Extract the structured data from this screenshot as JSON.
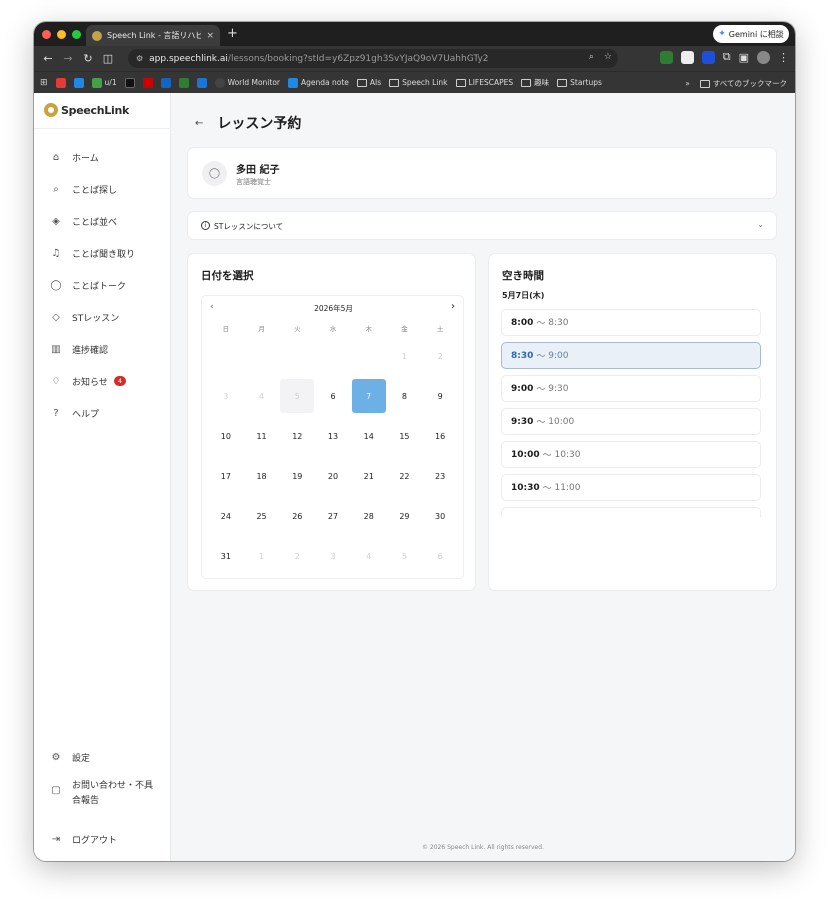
{
  "browser": {
    "tab_title": "Speech Link - 言語リハビリ支援",
    "new_tab": "+",
    "close": "×",
    "gemini_label": "Gemini に相談",
    "url_host": "app.speechlink.ai",
    "url_path": "/lessons/booking?stId=y6Zpz91gh3SvYJaQ9oV7UahhGTy2",
    "bookmarks": [
      "u/1",
      "World Monitor",
      "Agenda note",
      "AIs",
      "Speech Link",
      "LIFESCAPES",
      "趣味",
      "Startups"
    ],
    "bookmarks_more": "»",
    "all_bookmarks": "すべてのブックマーク"
  },
  "app": {
    "logo": "SpeechLink",
    "menu": [
      {
        "label": "ホーム",
        "icon": "home-icon"
      },
      {
        "label": "ことば探し",
        "icon": "search-icon"
      },
      {
        "label": "ことば並べ",
        "icon": "layers-icon"
      },
      {
        "label": "ことば聞き取り",
        "icon": "headphones-icon"
      },
      {
        "label": "ことばトーク",
        "icon": "chat-icon"
      },
      {
        "label": "STレッスン",
        "icon": "graduation-cap-icon"
      },
      {
        "label": "進捗確認",
        "icon": "bar-chart-icon"
      },
      {
        "label": "お知らせ",
        "icon": "bell-icon",
        "badge": "4"
      },
      {
        "label": "ヘルプ",
        "icon": "help-icon"
      }
    ],
    "bottom_menu": {
      "settings": "設定",
      "contact_line1": "お問い合わせ・不具",
      "contact_line2": "合報告",
      "logout": "ログアウト"
    }
  },
  "page": {
    "title": "レッスン予約",
    "therapist_name": "多田 紀子",
    "therapist_role": "言語聴覚士",
    "about_label": "STレッスンについて",
    "date_section_title": "日付を選択",
    "slot_section_title": "空き時間",
    "footer": "© 2026 Speech Link. All rights reserved."
  },
  "calendar": {
    "month_label": "2026年5月",
    "weekdays": [
      "日",
      "月",
      "火",
      "水",
      "木",
      "金",
      "土"
    ],
    "selected_date_label": "5月7日(木)"
  },
  "slots": [
    {
      "start": "8:00",
      "end": "8:30"
    },
    {
      "start": "8:30",
      "end": "9:00"
    },
    {
      "start": "9:00",
      "end": "9:30"
    },
    {
      "start": "9:30",
      "end": "10:00"
    },
    {
      "start": "10:00",
      "end": "10:30"
    },
    {
      "start": "10:30",
      "end": "11:00"
    }
  ],
  "slot_separator": "〜",
  "colors": {
    "selected_day": "#6db0e6",
    "active_slot": "#2b67b5",
    "badge": "#d62b2b"
  }
}
